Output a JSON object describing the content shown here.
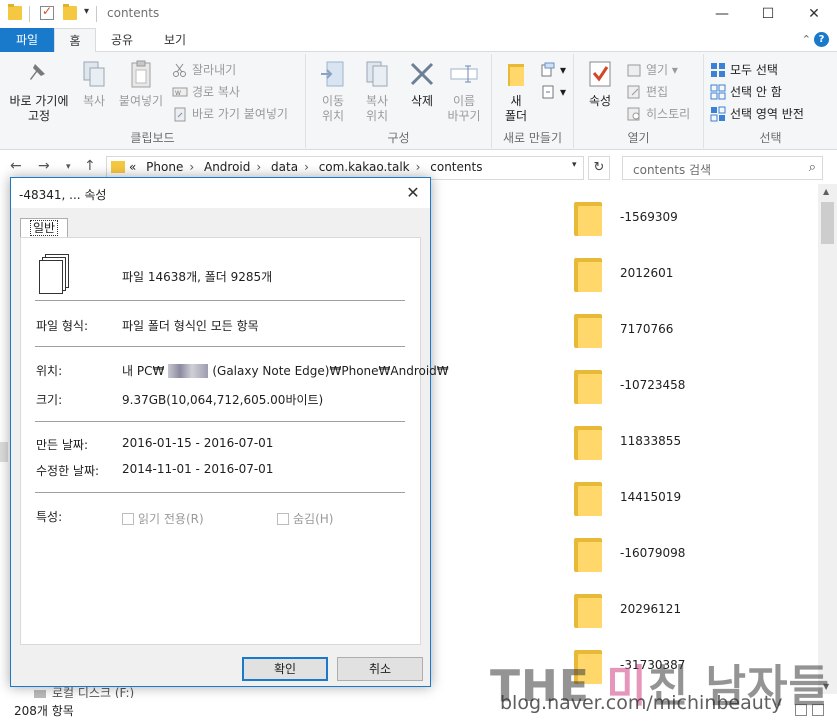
{
  "window": {
    "title": "contents",
    "minimize": "—",
    "maximize": "☐",
    "close": "✕"
  },
  "ribbon_tabs": {
    "file": "파일",
    "home": "홈",
    "share": "공유",
    "view": "보기",
    "minimize_ribbon": "⌃",
    "help": "?"
  },
  "clipboard": {
    "pin_quick_access": "바로 가기에\n고정",
    "copy": "복사",
    "paste": "붙여넣기",
    "cut": "잘라내기",
    "copy_path": "경로 복사",
    "paste_shortcut": "바로 가기 붙여넣기",
    "group_label": "클립보드"
  },
  "organize": {
    "move_to": "이동\n위치",
    "copy_to": "복사\n위치",
    "delete": "삭제",
    "rename": "이름\n바꾸기",
    "group_label": "구성"
  },
  "new": {
    "new_folder": "새\n폴더",
    "group_label": "새로 만들기"
  },
  "open": {
    "properties": "속성",
    "open": "열기",
    "edit": "편집",
    "history": "히스토리",
    "group_label": "열기"
  },
  "select": {
    "select_all": "모두 선택",
    "select_none": "선택 안 함",
    "invert_selection": "선택 영역 반전",
    "group_label": "선택"
  },
  "address": {
    "overflow": "«",
    "crumbs": [
      "Phone",
      "Android",
      "data",
      "com.kakao.talk",
      "contents"
    ],
    "search_placeholder": "contents 검색"
  },
  "files": [
    {
      "name": "-1569309"
    },
    {
      "name": "2012601"
    },
    {
      "name": "7170766"
    },
    {
      "name": "-10723458"
    },
    {
      "name": "11833855"
    },
    {
      "name": "14415019"
    },
    {
      "name": "-16079098"
    },
    {
      "name": "20296121"
    },
    {
      "name": "-31730387"
    }
  ],
  "nav_pane": {
    "local_disk": "로컬 디스크 (F:)"
  },
  "status": {
    "item_count": "208개 항목"
  },
  "watermark": {
    "title_pre": "THE ",
    "title_pink": "미",
    "title_post": "친 남자들",
    "url": "blog.naver.com/michinbeauty"
  },
  "dialog": {
    "title": "-48341, ... 속성",
    "tab_general": "일반",
    "summary": "파일 14638개, 폴더 9285개",
    "type_label": "파일 형식:",
    "type_value": "파일 폴더 형식인 모든 항목",
    "location_label": "위치:",
    "location_prefix": "내 PC₩",
    "location_suffix": "(Galaxy Note Edge)₩Phone₩Android₩",
    "size_label": "크기:",
    "size_value": "9.37GB(10,064,712,605.00바이트)",
    "created_label": "만든 날짜:",
    "created_value": "2016-01-15 - 2016-07-01",
    "modified_label": "수정한 날짜:",
    "modified_value": "2014-11-01 - 2016-07-01",
    "attributes_label": "특성:",
    "readonly": "읽기 전용(R)",
    "hidden": "숨김(H)",
    "ok": "확인",
    "cancel": "취소"
  }
}
